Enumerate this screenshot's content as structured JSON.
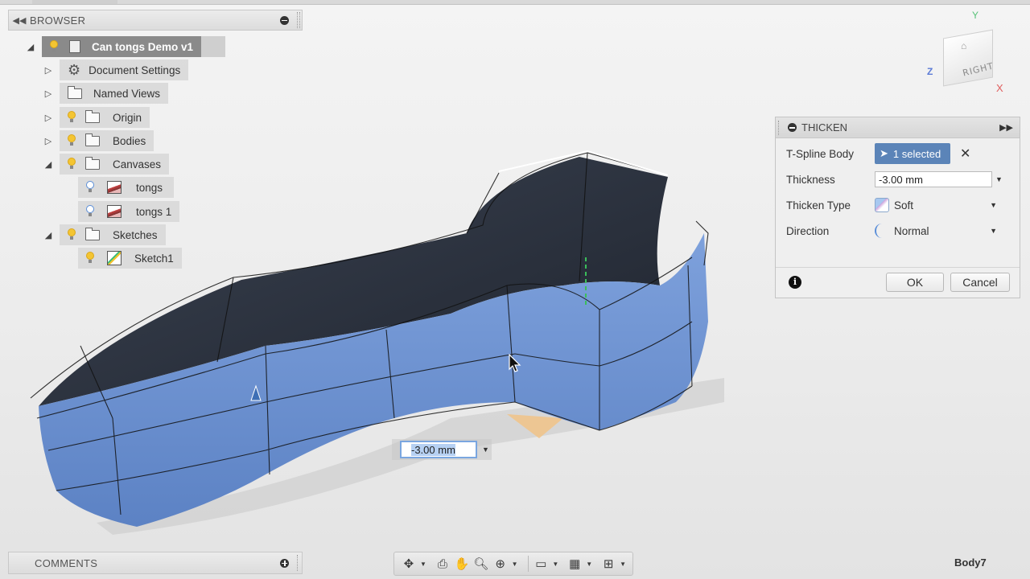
{
  "browser": {
    "title": "BROWSER",
    "root": {
      "label": "Can tongs Demo v1"
    },
    "items": [
      {
        "label": "Document Settings"
      },
      {
        "label": "Named Views"
      },
      {
        "label": "Origin"
      },
      {
        "label": "Bodies"
      },
      {
        "label": "Canvases"
      },
      {
        "label": "tongs"
      },
      {
        "label": "tongs 1"
      },
      {
        "label": "Sketches"
      },
      {
        "label": "Sketch1"
      }
    ]
  },
  "dialog": {
    "title": "THICKEN",
    "tspline_body_label": "T-Spline Body",
    "selection": "1 selected",
    "thickness_label": "Thickness",
    "thickness_value": "-3.00 mm",
    "thicken_type_label": "Thicken Type",
    "thicken_type_value": "Soft",
    "direction_label": "Direction",
    "direction_value": "Normal",
    "ok": "OK",
    "cancel": "Cancel"
  },
  "canvas": {
    "thickness_input": "-3.00 mm",
    "viewcube_face": "RIGHT",
    "axis_x": "X",
    "axis_y": "Y",
    "axis_z": "Z"
  },
  "comments": {
    "title": "COMMENTS"
  },
  "status": {
    "active_body": "Body7"
  },
  "colors": {
    "selection_blue": "#5b84b8",
    "surface_blue": "#6f93cf",
    "surface_dark": "#2f3645",
    "sketch_plane": "#f0c48c"
  }
}
